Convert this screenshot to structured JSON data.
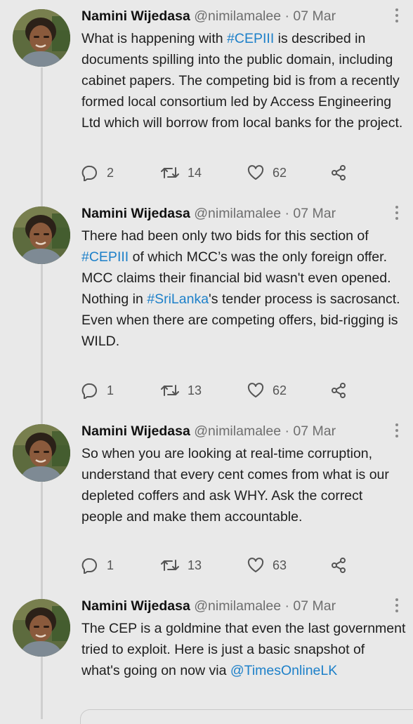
{
  "tweets": [
    {
      "author": "Namini Wijedasa",
      "handle": "@nimilamalee",
      "separator": "·",
      "date": "07 Mar",
      "body": [
        {
          "t": "What is happening with "
        },
        {
          "t": "#CEPIII",
          "link": true
        },
        {
          "t": " is described in documents spilling into the public domain, including cabinet papers. The competing bid is from a recently formed local consortium led by Access Engineering Ltd which will borrow from local banks for the project."
        }
      ],
      "replies": "2",
      "retweets": "14",
      "likes": "62"
    },
    {
      "author": "Namini Wijedasa",
      "handle": "@nimilamalee",
      "separator": "·",
      "date": "07 Mar",
      "body": [
        {
          "t": "There had been only two bids for this section of "
        },
        {
          "t": "#CEPIII",
          "link": true
        },
        {
          "t": " of which MCC’s was the only foreign offer. MCC claims their financial bid wasn't even opened. Nothing in "
        },
        {
          "t": "#SriLanka",
          "link": true
        },
        {
          "t": "'s tender process is sacrosanct. Even when there are competing offers, bid-rigging is WILD."
        }
      ],
      "replies": "1",
      "retweets": "13",
      "likes": "62"
    },
    {
      "author": "Namini Wijedasa",
      "handle": "@nimilamalee",
      "separator": "·",
      "date": "07 Mar",
      "body": [
        {
          "t": "So when you are looking at real-time corruption, understand that every cent comes from what is our depleted coffers and ask WHY. Ask the correct people and make them accountable."
        }
      ],
      "replies": "1",
      "retweets": "13",
      "likes": "63"
    },
    {
      "author": "Namini Wijedasa",
      "handle": "@nimilamalee",
      "separator": "·",
      "date": "07 Mar",
      "body": [
        {
          "t": "The CEP is a goldmine that even the last government tried to exploit. Here is just a basic snapshot of what's going on now via "
        },
        {
          "t": "@TimesOnlineLK",
          "link": true
        }
      ]
    }
  ],
  "icons": {
    "reply": "reply-icon",
    "retweet": "retweet-icon",
    "like": "heart-icon",
    "share": "share-icon",
    "more": "more-options-icon"
  },
  "colors": {
    "background": "#e9e9e9",
    "link": "#1d80c9",
    "muted": "#6e6e6e"
  }
}
